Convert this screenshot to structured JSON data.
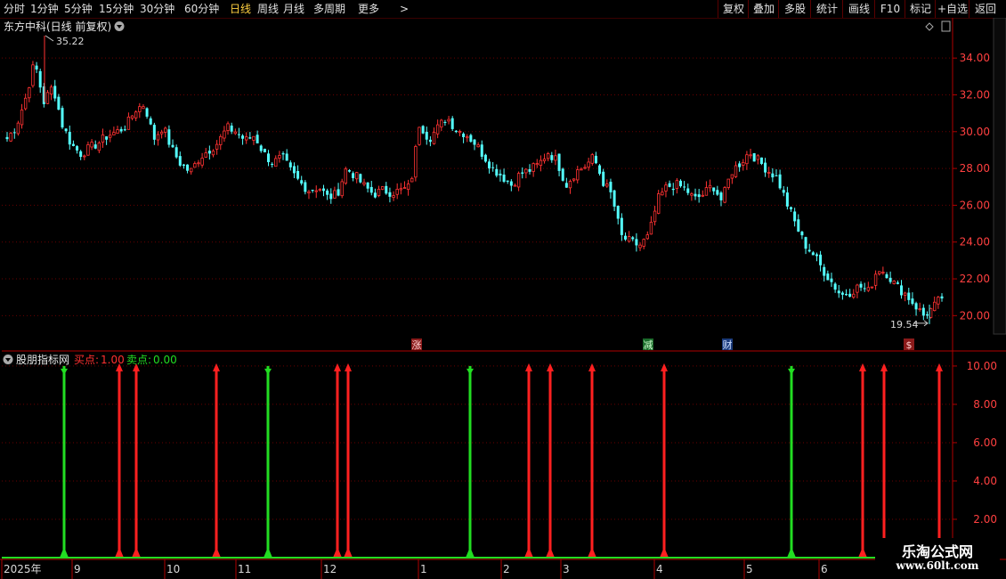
{
  "toolbar": {
    "timeframes": [
      "分时",
      "1分钟",
      "5分钟",
      "15分钟",
      "30分钟",
      "60分钟",
      "日线",
      "周线",
      "月线",
      "多周期",
      "更多"
    ],
    "active_timeframe": "日线",
    "more_arrow": ">",
    "buttons": [
      "复权",
      "叠加",
      "多股",
      "统计",
      "画线",
      "F10",
      "标记",
      "+自选",
      "返回"
    ]
  },
  "main_chart": {
    "stock_title": "东方中科(日线 前复权)",
    "high_label": "35.22",
    "low_label": "19.54",
    "events": [
      "涨",
      "减",
      "财",
      "$"
    ]
  },
  "indicator": {
    "name": "股朋指标网",
    "buy_label": "买点:",
    "buy_value": "1.00",
    "sell_label": "卖点:",
    "sell_value": "0.00"
  },
  "x_axis": {
    "labels": [
      "2025年",
      "9",
      "10",
      "11",
      "12",
      "1",
      "2",
      "3",
      "4",
      "5",
      "6"
    ]
  },
  "watermark": {
    "line1": "乐淘公式网",
    "line2": "www.60lt.com"
  },
  "colors": {
    "up": "#ff3232",
    "down": "#54ffff",
    "buy": "#ff2020",
    "sell": "#22dd22",
    "active": "#ffd040",
    "grid": "#6a0000"
  },
  "chart_data": [
    {
      "type": "candlestick",
      "title": "东方中科(日线 前复权)",
      "ylim": [
        19.0,
        35.8
      ],
      "y_ticks": [
        "20.00",
        "22.00",
        "24.00",
        "26.00",
        "28.00",
        "30.00",
        "32.00",
        "34.00"
      ],
      "annotations": [
        {
          "text": "35.22",
          "value": 35.22
        },
        {
          "text": "19.54",
          "value": 19.54
        }
      ],
      "anchors": [
        29.6,
        30.3,
        31.8,
        33.8,
        31.6,
        32.5,
        30.4,
        29.3,
        28.8,
        29.1,
        29.4,
        29.8,
        30.0,
        30.3,
        31.2,
        31.5,
        29.6,
        30.3,
        29.0,
        28.2,
        27.8,
        28.6,
        29.0,
        29.4,
        30.2,
        30.0,
        29.5,
        29.8,
        28.8,
        28.3,
        28.6,
        27.8,
        27.2,
        26.8,
        27.0,
        26.4,
        26.6,
        28.0,
        27.6,
        27.0,
        26.6,
        26.8,
        26.7,
        26.8,
        27.0,
        30.5,
        29.6,
        30.2,
        30.8,
        30.1,
        29.9,
        29.4,
        28.7,
        28.0,
        27.6,
        27.1,
        27.7,
        27.9,
        28.2,
        28.9,
        28.4,
        27.1,
        27.8,
        28.1,
        28.6,
        27.3,
        26.5,
        24.3,
        24.0,
        23.8,
        24.3,
        26.3,
        27.0,
        27.1,
        26.9,
        26.3,
        26.6,
        27.1,
        26.2,
        27.8,
        28.3,
        28.9,
        28.4,
        27.9,
        27.5,
        26.2,
        25.0,
        23.9,
        23.3,
        22.5,
        21.8,
        21.1,
        21.3,
        21.6,
        21.3,
        22.6,
        22.3,
        21.6,
        21.2,
        20.6,
        20.0,
        20.4,
        21.0
      ],
      "volatility": 0.55
    },
    {
      "type": "signal",
      "title": "股朋指标网",
      "ylim": [
        0,
        10.6
      ],
      "y_ticks": [
        "2.00",
        "4.00",
        "6.00",
        "8.00",
        "10.00"
      ],
      "series": [
        {
          "name": "买点",
          "value": 1.0,
          "x_index": [
            134,
            153,
            243,
            379,
            391,
            594,
            618,
            665,
            746,
            969,
            993,
            1055
          ]
        },
        {
          "name": "卖点",
          "value": 0.0,
          "x_index": [
            72,
            301,
            528,
            889
          ]
        }
      ]
    }
  ]
}
